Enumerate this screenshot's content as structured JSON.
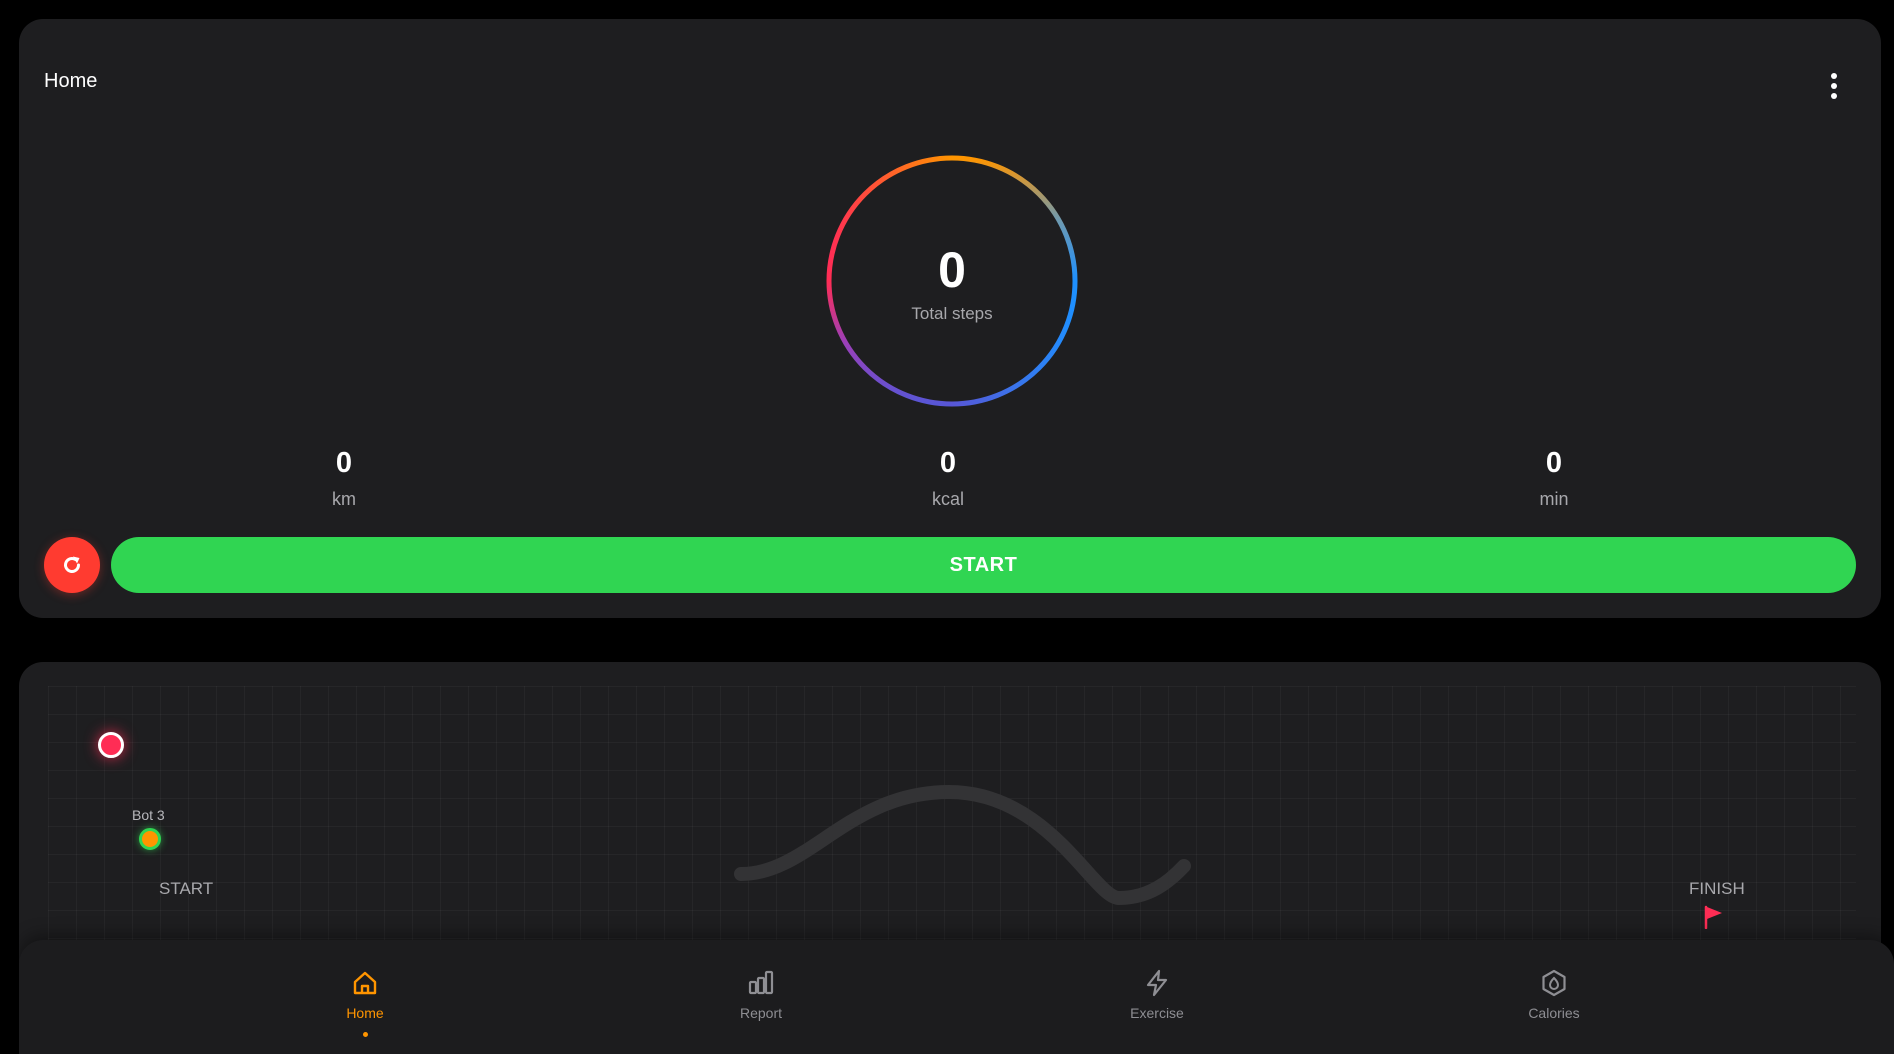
{
  "header": {
    "title": "Home",
    "menu_icon": "more-vertical-icon"
  },
  "steps": {
    "value": "0",
    "label": "Total steps",
    "ring_colors": [
      "#ff9500",
      "#1e90ff",
      "#5856d6",
      "#ff2d55"
    ]
  },
  "stats": [
    {
      "value": "0",
      "unit": "km"
    },
    {
      "value": "0",
      "unit": "kcal"
    },
    {
      "value": "0",
      "unit": "min"
    }
  ],
  "actions": {
    "reset_icon": "refresh-icon",
    "start_label": "START",
    "start_color": "#30d552",
    "reset_color": "#ff3b30"
  },
  "race": {
    "bot_label": "Bot 3",
    "start_label": "START",
    "finish_label": "FINISH",
    "player_color": "#ff2d55",
    "bot_color": "#ff9500"
  },
  "nav": {
    "items": [
      {
        "label": "Home",
        "icon": "home-icon",
        "active": true
      },
      {
        "label": "Report",
        "icon": "bar-chart-icon",
        "active": false
      },
      {
        "label": "Exercise",
        "icon": "lightning-icon",
        "active": false
      },
      {
        "label": "Calories",
        "icon": "hexagon-icon",
        "active": false
      }
    ],
    "active_color": "#ff9500",
    "inactive_color": "#8e8e93"
  }
}
